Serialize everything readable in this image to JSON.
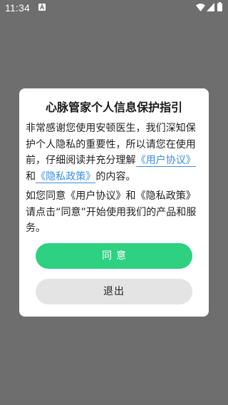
{
  "status_bar": {
    "time": "11:34",
    "icons": [
      "notification-a-icon",
      "wifi-icon",
      "signal-icon",
      "battery-icon"
    ]
  },
  "dialog": {
    "title": "心脉管家个人信息保护指引",
    "para1": {
      "text_a": "非常感谢您使用安顿医生，我们深知保护个人隐私的重要性，所以请您在使用前，仔细阅读并充分理解",
      "link_user_agreement": "《用户协议》",
      "text_b": "和",
      "link_privacy_policy": "《隐私政策》",
      "text_c": "的内容。"
    },
    "para2": "如您同意《用户协议》和《隐私政策》请点击“同意”开始使用我们的产品和服务。",
    "agree_label": "同意",
    "exit_label": "退出"
  },
  "colors": {
    "backdrop": "#6e6e6e",
    "accent_green": "#2ed081",
    "link_blue": "#3d8ee0",
    "exit_button_bg": "#e4e4e4"
  }
}
